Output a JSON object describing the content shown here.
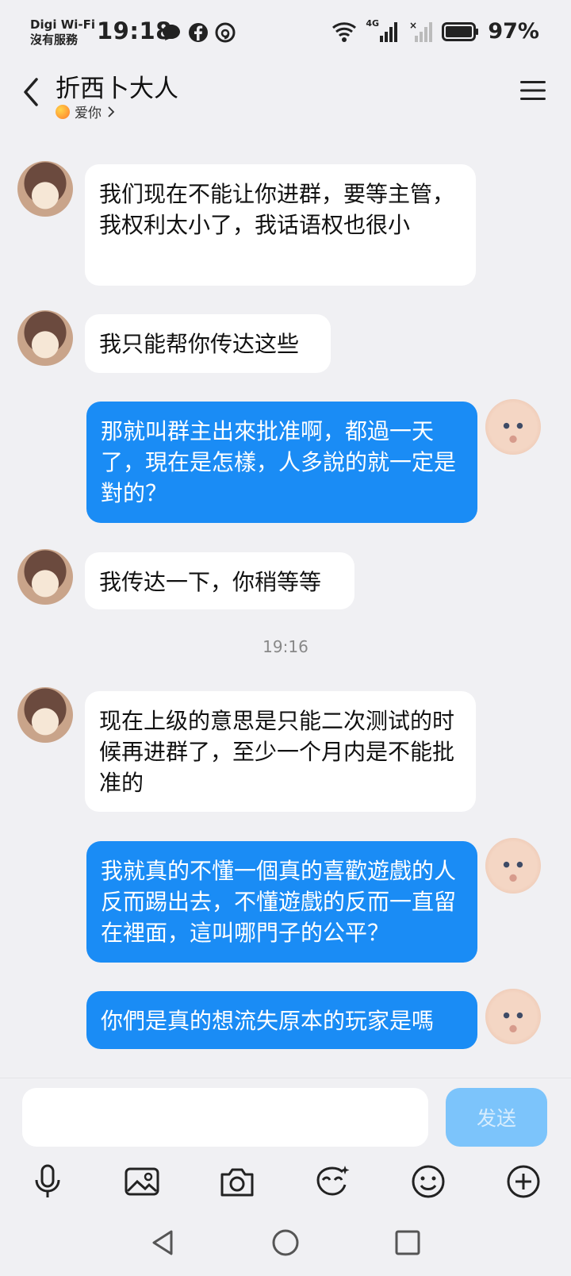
{
  "status_bar": {
    "carrier_line1": "Digi Wi-Fi",
    "carrier_line2": "沒有服務",
    "time": "19:18",
    "network_label": "4G",
    "battery": "97%"
  },
  "header": {
    "title": "折西卜大人",
    "subtitle": "爱你"
  },
  "messages": [
    {
      "side": "left",
      "text": "我们现在不能让你进群，要等主管，我权利太小了，我话语权也很小"
    },
    {
      "side": "left",
      "text": "我只能帮你传达这些"
    },
    {
      "side": "right",
      "text": "那就叫群主出來批准啊，都過一天了，現在是怎樣，人多說的就一定是對的？"
    },
    {
      "side": "left",
      "text": "我传达一下，你稍等等"
    },
    {
      "side": "left",
      "text": "现在上级的意思是只能二次测试的时候再进群了，至少一个月内是不能批准的"
    },
    {
      "side": "right",
      "text": "我就真的不懂一個真的喜歡遊戲的人反而踢出去，不懂遊戲的反而一直留在裡面，這叫哪門子的公平？"
    },
    {
      "side": "right",
      "text": "你們是真的想流失原本的玩家是嗎"
    }
  ],
  "timestamp": "19:16",
  "composer": {
    "input_value": "",
    "send_label": "发送"
  },
  "colors": {
    "sent_bubble": "#1a8cf5",
    "received_bubble": "#ffffff",
    "send_button": "#7cc4fb"
  }
}
